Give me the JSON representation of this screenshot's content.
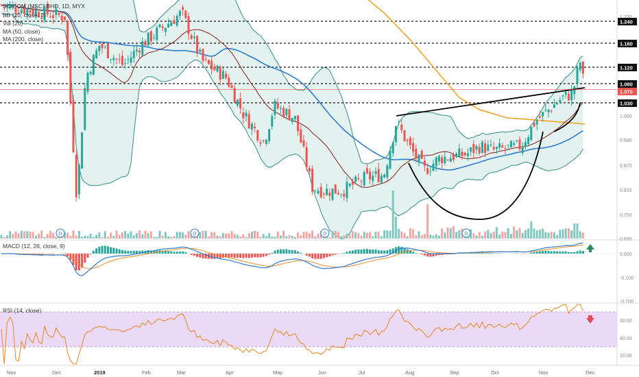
{
  "header": {
    "title": "SCICOM (MSC) BHD, 1D, MYX",
    "legend": [
      "BB (20, close, 2)",
      "Vol (20)",
      "MA (50, close)",
      "MA (200, close)"
    ]
  },
  "colors": {
    "up": "#26a69a",
    "down": "#ef5350",
    "bb": "#2f8f86",
    "bb_fill": "#e3f2ef",
    "ma20": "#8b1a1a",
    "ma50": "#2e7bcf",
    "ma200": "#f0a32b",
    "macd_line": "#2e7bcf",
    "macd_signal": "#f08a24",
    "rsi_line": "#f0831b",
    "rsi_band": "#ead9f7",
    "price_label": "#ef5350"
  },
  "price_axis": {
    "ticks": [
      "1.250",
      "1.000",
      "0.940",
      "0.875",
      "0.815",
      "0.750",
      "0.690"
    ],
    "levels": [
      {
        "label": "1.240",
        "value": 1.24
      },
      {
        "label": "1.180",
        "value": 1.18
      },
      {
        "label": "1.120",
        "value": 1.12
      },
      {
        "label": "1.080",
        "value": 1.08
      },
      {
        "label": "1.030",
        "value": 1.03
      }
    ],
    "last_price": "1.070"
  },
  "x_axis_labels": [
    "Nov",
    "Dec",
    "2019",
    "Feb",
    "Mar",
    "Apr",
    "May",
    "Jun",
    "Jul",
    "Aug",
    "Sep",
    "Oct",
    "Nov",
    "Dec"
  ],
  "dividend_marker": "D",
  "macd": {
    "title": "MACD (12, 26, close, 9)",
    "ticks": [
      "0.000",
      "-0.100",
      "-0.200"
    ]
  },
  "rsi": {
    "title": "RSI (14, close)",
    "ticks": [
      "60.00",
      "40.00",
      "20.00"
    ]
  },
  "chart_data": {
    "type": "candlestick",
    "price_range": [
      0.69,
      1.28
    ],
    "macd_range": [
      -0.2,
      0.04
    ],
    "rsi_range": [
      10,
      80
    ],
    "rsi_band": [
      30,
      70
    ],
    "anchors": [
      {
        "date": "2018-11",
        "close": 1.28
      },
      {
        "date": "2018-12-10",
        "close": 0.8
      },
      {
        "date": "2019-01",
        "close": 1.1
      },
      {
        "date": "2019-03-01",
        "close": 1.26
      },
      {
        "date": "2019-04-20",
        "close": 0.94
      },
      {
        "date": "2019-05-10",
        "close": 1.0
      },
      {
        "date": "2019-06-05",
        "close": 0.83
      },
      {
        "date": "2019-07-20",
        "close": 0.85
      },
      {
        "date": "2019-07-28",
        "close": 0.99
      },
      {
        "date": "2019-08-25",
        "close": 0.9
      },
      {
        "date": "2019-10-10",
        "close": 0.93
      },
      {
        "date": "2019-11-15",
        "close": 1.02
      },
      {
        "date": "2019-11-28",
        "close": 1.14
      },
      {
        "date": "2019-11-30",
        "close": 1.07
      }
    ]
  }
}
